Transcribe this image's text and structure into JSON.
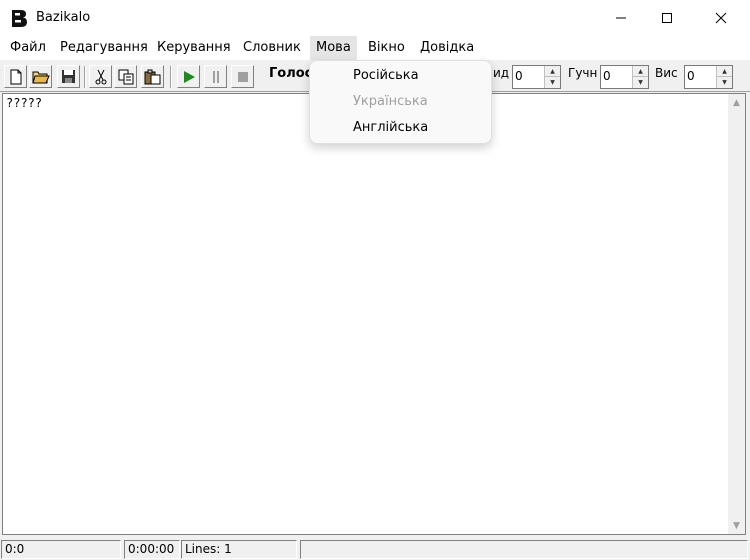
{
  "window": {
    "title": "Bazikalo",
    "icon": "app-icon"
  },
  "menu": {
    "file": "Файл",
    "edit": "Редагування",
    "control": "Керування",
    "dictionary": "Словник",
    "language": "Мова",
    "window": "Вікно",
    "help": "Довідка"
  },
  "toolbar": {
    "icons": [
      "new-file-icon",
      "open-folder-icon",
      "save-icon",
      "cut-icon",
      "copy-icon",
      "paste-icon",
      "play-icon",
      "pause-icon",
      "stop-icon"
    ],
    "voice_label": "Голос",
    "speed_label": "ид",
    "speed_value": "0",
    "volume_label": "Гучн",
    "volume_value": "0",
    "pitch_label": "Вис",
    "pitch_value": "0"
  },
  "language_menu": {
    "items": [
      {
        "label": "Російська",
        "enabled": true
      },
      {
        "label": "Українська",
        "enabled": false
      },
      {
        "label": "Англійська",
        "enabled": true
      }
    ]
  },
  "editor": {
    "text": "?????"
  },
  "status": {
    "position": "0:0",
    "time": "0:00:00",
    "lines": "Lines: 1"
  }
}
